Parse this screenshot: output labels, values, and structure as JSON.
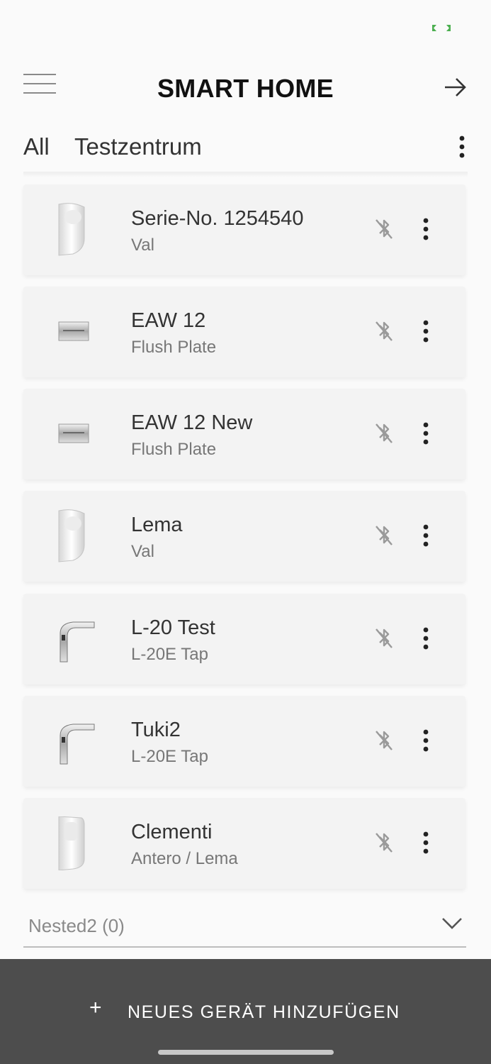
{
  "status_bar": {
    "battery_icon": "battery-charging-icon",
    "battery_color": "#4caf50"
  },
  "header": {
    "title": "SMART HOME",
    "menu_icon": "hamburger-menu-icon",
    "action_icon": "arrow-right-icon"
  },
  "tabs": {
    "items": [
      {
        "label": "All"
      },
      {
        "label": "Testzentrum"
      }
    ],
    "more_icon": "kebab-menu-icon"
  },
  "devices": [
    {
      "name": "Serie-No. 1254540",
      "type": "Val",
      "image": "urinal-image",
      "bluetooth": "bluetooth-disabled-icon"
    },
    {
      "name": "EAW 12",
      "type": "Flush Plate",
      "image": "flush-plate-image",
      "bluetooth": "bluetooth-disabled-icon"
    },
    {
      "name": "EAW 12 New",
      "type": "Flush Plate",
      "image": "flush-plate-image",
      "bluetooth": "bluetooth-disabled-icon"
    },
    {
      "name": "Lema",
      "type": "Val",
      "image": "urinal-image",
      "bluetooth": "bluetooth-disabled-icon"
    },
    {
      "name": "L-20 Test",
      "type": "L-20E Tap",
      "image": "tap-image",
      "bluetooth": "bluetooth-disabled-icon"
    },
    {
      "name": "Tuki2",
      "type": "L-20E Tap",
      "image": "tap-image",
      "bluetooth": "bluetooth-disabled-icon"
    },
    {
      "name": "Clementi",
      "type": "Antero / Lema",
      "image": "tall-urinal-image",
      "bluetooth": "bluetooth-disabled-icon"
    }
  ],
  "group": {
    "label": "Nested2 (0)",
    "icon": "chevron-down-icon"
  },
  "footer": {
    "plus": "+",
    "add_label": "NEUES GERÄT HINZUFÜGEN"
  },
  "colors": {
    "accent_bar": "#4d4d4d",
    "card_bg": "#f3f3f3",
    "text_secondary": "#777777"
  }
}
